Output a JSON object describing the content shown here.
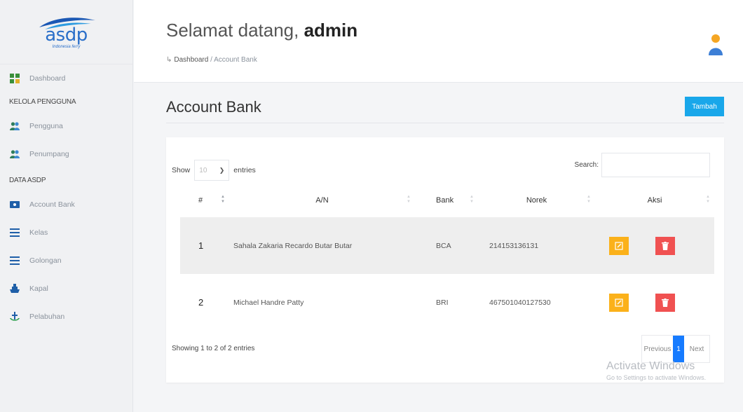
{
  "brand": {
    "logo_text": "asdp",
    "logo_sub": "Indonesia ferry",
    "colors": {
      "primary": "#2a6fc9",
      "accent": "#19a7ea",
      "edit": "#fbb11a",
      "delete": "#f05151"
    }
  },
  "sidebar": {
    "dashboard": {
      "label": "Dashboard",
      "icon": "dashboard-icon"
    },
    "section_users": "KELOLA PENGGUNA",
    "users_items": [
      {
        "label": "Pengguna",
        "icon": "users-icon"
      },
      {
        "label": "Penumpang",
        "icon": "users-icon"
      }
    ],
    "section_data": "DATA ASDP",
    "data_items": [
      {
        "label": "Account Bank",
        "icon": "bank-card-icon"
      },
      {
        "label": "Kelas",
        "icon": "list-icon"
      },
      {
        "label": "Golongan",
        "icon": "list-icon"
      },
      {
        "label": "Kapal",
        "icon": "ship-icon"
      },
      {
        "label": "Pelabuhan",
        "icon": "anchor-icon"
      }
    ]
  },
  "header": {
    "welcome": "Selamat datang,",
    "user": "admin",
    "crumb_root": "Dashboard",
    "crumb_sep": " / ",
    "crumb_current": "Account Bank"
  },
  "page": {
    "title": "Account Bank",
    "add_button": "Tambah"
  },
  "table_controls": {
    "show": "Show",
    "length_value": "10",
    "entries": "entries",
    "search_label": "Search:"
  },
  "table": {
    "columns": [
      "#",
      "A/N",
      "Bank",
      "Norek",
      "Aksi"
    ],
    "rows": [
      {
        "no": "1",
        "an": "Sahala Zakaria Recardo Butar Butar",
        "bank": "BCA",
        "norek": "214153136131"
      },
      {
        "no": "2",
        "an": "Michael Handre Patty",
        "bank": "BRI",
        "norek": "467501040127530"
      }
    ]
  },
  "footer": {
    "info": "Showing 1 to 2 of 2 entries",
    "prev": "Previous",
    "page": "1",
    "next": "Next"
  },
  "watermark": {
    "line1": "Activate Windows",
    "line2": "Go to Settings to activate Windows."
  }
}
